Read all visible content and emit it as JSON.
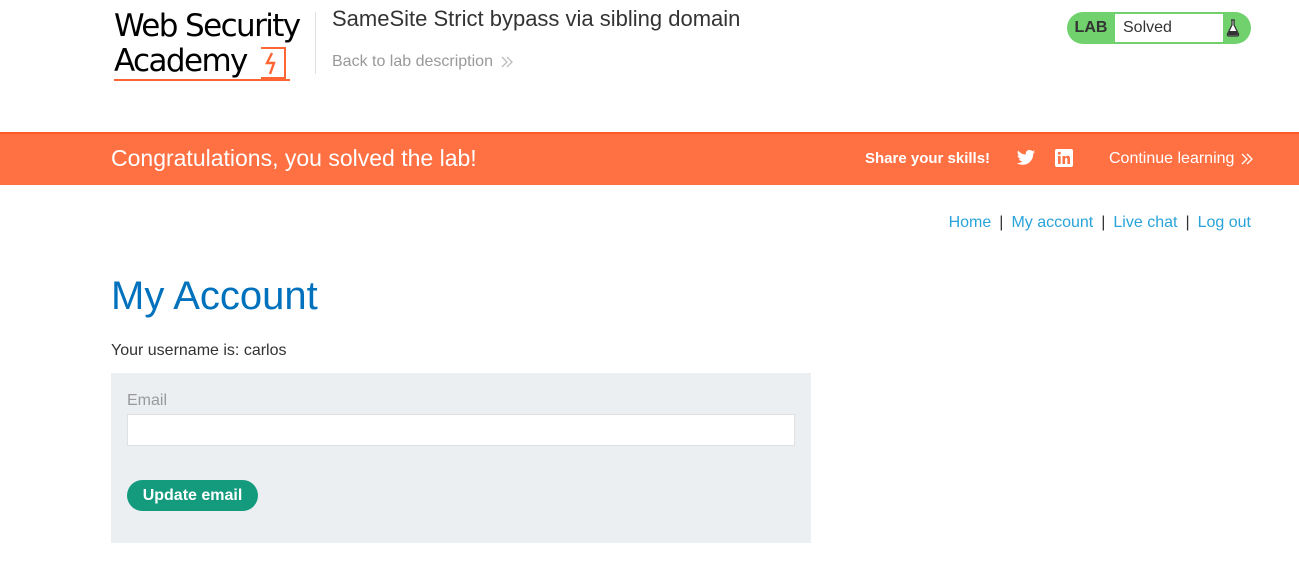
{
  "header": {
    "logo_line1": "Web Security",
    "logo_line2": "Academy",
    "lab_title": "SameSite Strict bypass via sibling domain",
    "back_link": "Back to lab description",
    "lab_status": {
      "tag": "LAB",
      "state": "Solved",
      "icon": "flask-icon"
    }
  },
  "banner": {
    "message": "Congratulations, you solved the lab!",
    "share_label": "Share your skills!",
    "social_icons": [
      "twitter-icon",
      "linkedin-icon"
    ],
    "continue_label": "Continue learning"
  },
  "nav": {
    "items": [
      {
        "label": "Home"
      },
      {
        "label": "My account"
      },
      {
        "label": "Live chat"
      },
      {
        "label": "Log out"
      }
    ],
    "separator": "|"
  },
  "main": {
    "title": "My Account",
    "username_line": "Your username is: carlos",
    "form": {
      "email_label": "Email",
      "email_value": "",
      "submit_label": "Update email"
    }
  },
  "colors": {
    "banner": "#ff7043",
    "link": "#29a3d9",
    "title": "#0071bc",
    "button": "#149b7e",
    "status_green": "#70d16d"
  }
}
